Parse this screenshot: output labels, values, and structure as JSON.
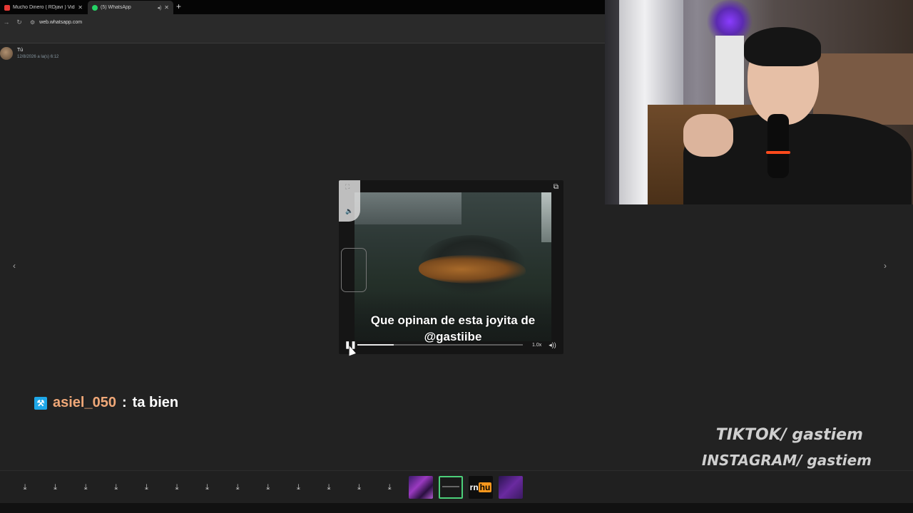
{
  "browser": {
    "tabs": [
      {
        "title": "Mucho Dinero ( RDjavi ) Video",
        "icon": "youtube-icon"
      },
      {
        "title": "(5) WhatsApp",
        "icon": "whatsapp-icon"
      }
    ],
    "url": "web.whatsapp.com"
  },
  "viewer": {
    "sender_name": "Tú",
    "sender_date": "12/8/2026 a la(s) 6:12",
    "prev_arrow": "‹",
    "next_arrow": "›"
  },
  "video": {
    "caption_line1": "Que opinan de esta joyita de",
    "caption_line2": "@gastiibe",
    "speed": "1.0x",
    "progress": 0.22
  },
  "chat": {
    "username": "asiel_050",
    "separator": ":",
    "message": "ta bien"
  },
  "socials": {
    "tiktok": "TIKTOK/ gastiem",
    "instagram": "INSTAGRAM/ gastiem"
  },
  "taskbar": {
    "download_count": 13,
    "thumb_text": "rn",
    "thumb_badge": "hu"
  },
  "colors": {
    "accent": "#25d366",
    "chat_user": "#f0a878",
    "badge": "#1ea7e8"
  }
}
